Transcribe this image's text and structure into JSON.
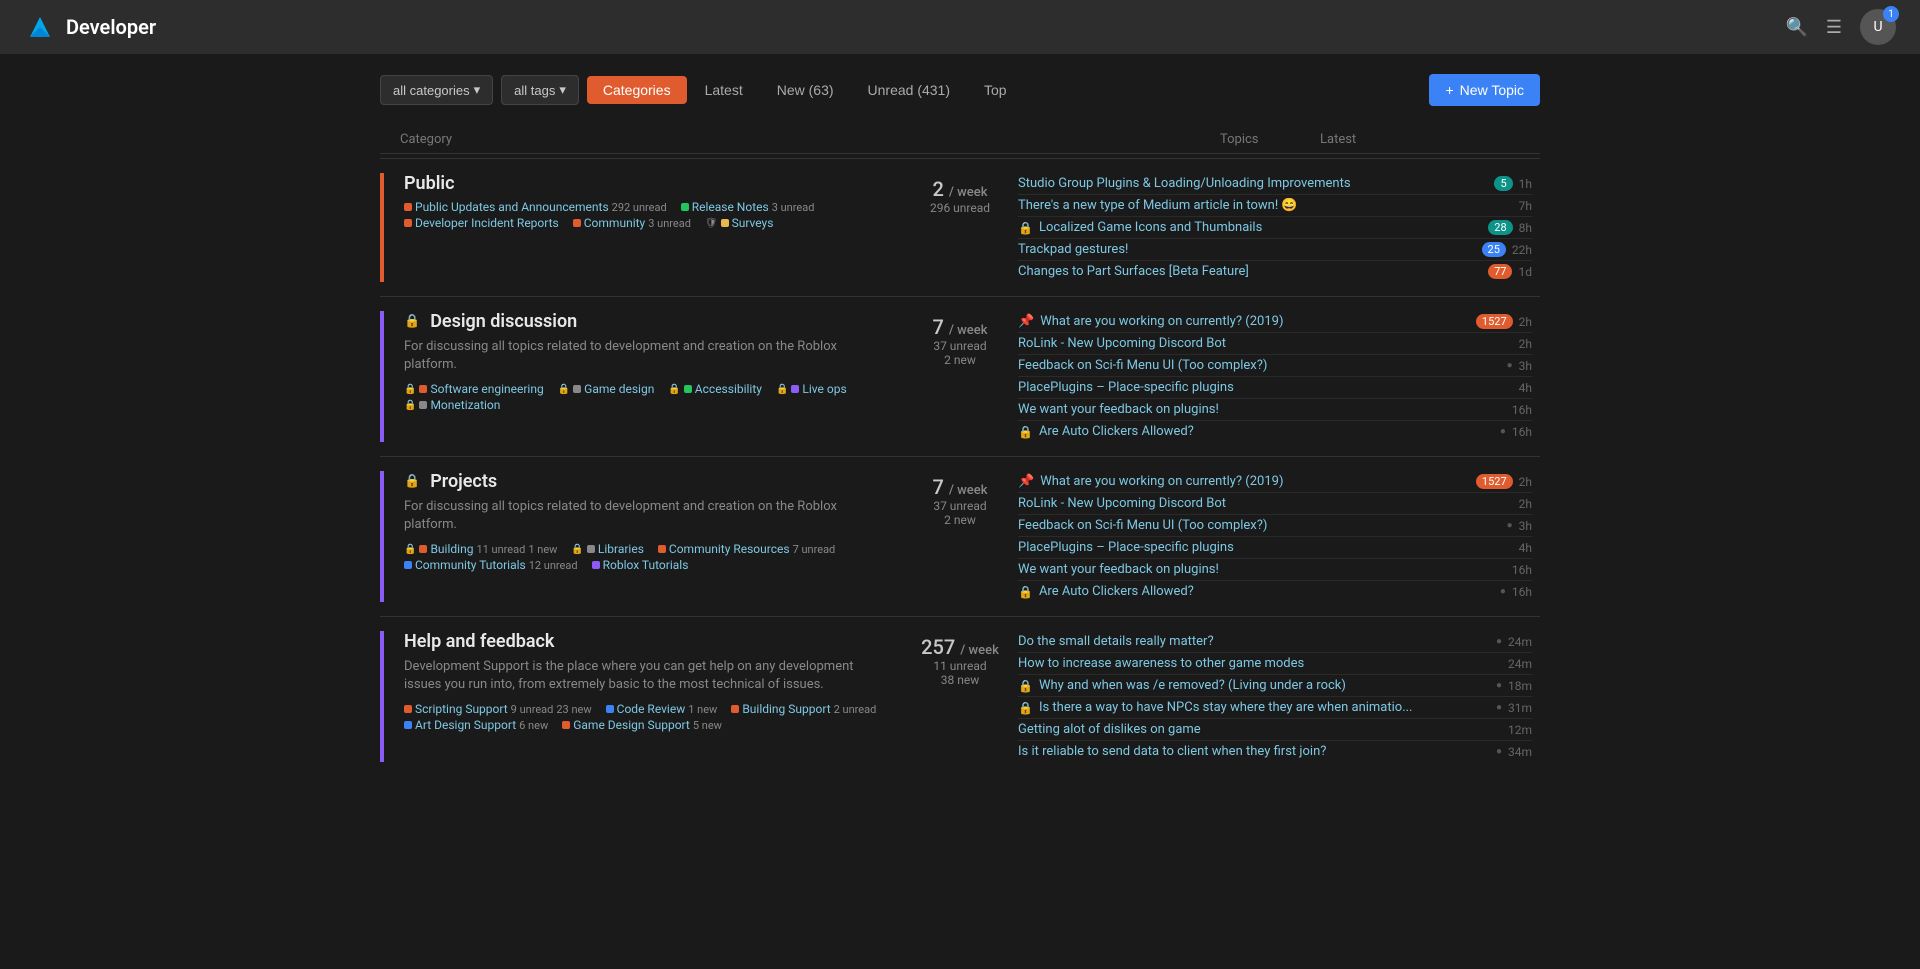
{
  "header": {
    "logo_text": "Developer",
    "search_icon": "🔍",
    "menu_icon": "☰",
    "avatar_badge": "1"
  },
  "topbar": {
    "filter_categories": "all categories",
    "filter_tags": "all tags",
    "tabs": [
      {
        "label": "Categories",
        "active": true
      },
      {
        "label": "Latest",
        "active": false
      },
      {
        "label": "New (63)",
        "active": false
      },
      {
        "label": "Unread (431)",
        "active": false
      },
      {
        "label": "Top",
        "active": false
      }
    ],
    "new_topic_label": "New Topic"
  },
  "table_header": {
    "col1": "Category",
    "col2": "Topics",
    "col3": "Latest"
  },
  "categories": [
    {
      "id": "public",
      "name": "Public",
      "lock": false,
      "color": "#e05c2e",
      "stats": {
        "num": "2",
        "per": "/ week",
        "unread": "296 unread"
      },
      "subcats": [
        {
          "name": "Public Updates and Announcements",
          "color": "#e05c2e",
          "unread": "292 unread"
        },
        {
          "name": "Release Notes",
          "color": "#22c55e",
          "unread": "3 unread"
        },
        {
          "name": "Developer Incident Reports",
          "color": "#e05c2e",
          "unread": ""
        },
        {
          "name": "Community",
          "color": "#e05c2e",
          "unread": "3 unread"
        },
        {
          "name": "Surveys",
          "color": "#e8b84b",
          "shield": true,
          "unread": ""
        }
      ],
      "topics": [
        {
          "title": "Studio Group Plugins & Loading/Unloading Improvements",
          "time": "1h",
          "badge": "5",
          "badge_color": "teal",
          "pinned": false,
          "lock": false
        },
        {
          "title": "There's a new type of Medium article in town! 😄",
          "time": "7h",
          "badge": "",
          "pinned": false,
          "lock": false
        },
        {
          "title": "Localized Game Icons and Thumbnails",
          "time": "8h",
          "badge": "28",
          "badge_color": "teal",
          "pinned": false,
          "lock": true
        },
        {
          "title": "Trackpad gestures!",
          "time": "22h",
          "badge": "25",
          "badge_color": "blue",
          "pinned": false,
          "lock": false
        },
        {
          "title": "Changes to Part Surfaces [Beta Feature]",
          "time": "1d",
          "badge": "77",
          "badge_color": "orange",
          "pinned": false,
          "lock": false
        }
      ]
    },
    {
      "id": "design",
      "name": "Design discussion",
      "lock": true,
      "color": "#8b5cf6",
      "desc": "For discussing all topics related to development and creation on the Roblox platform.",
      "stats": {
        "num": "7",
        "per": "/ week",
        "unread": "37 unread",
        "new": "2 new"
      },
      "subcats": [
        {
          "name": "Software engineering",
          "color": "#e05c2e",
          "lock": true,
          "unread": ""
        },
        {
          "name": "Game design",
          "color": "#888",
          "lock": true,
          "unread": ""
        },
        {
          "name": "Accessibility",
          "color": "#22c55e",
          "lock": true,
          "unread": ""
        },
        {
          "name": "Live ops",
          "color": "#8b5cf6",
          "lock": true,
          "unread": ""
        },
        {
          "name": "Monetization",
          "color": "#888",
          "lock": true,
          "unread": ""
        }
      ],
      "topics": [
        {
          "title": "What are you working on currently? (2019)",
          "time": "2h",
          "badge": "1527",
          "badge_color": "orange",
          "pinned": true,
          "lock": false
        },
        {
          "title": "RoLink - New Upcoming Discord Bot",
          "time": "2h",
          "badge": "",
          "pinned": false,
          "lock": false
        },
        {
          "title": "Feedback on Sci-fi Menu UI (Too complex?)",
          "time": "3h",
          "badge": "",
          "pinned": false,
          "lock": false,
          "dot": true
        },
        {
          "title": "PlacePlugins – Place-specific plugins",
          "time": "4h",
          "badge": "",
          "pinned": false,
          "lock": false
        },
        {
          "title": "We want your feedback on plugins!",
          "time": "16h",
          "badge": "",
          "pinned": false,
          "lock": false
        },
        {
          "title": "Are Auto Clickers Allowed?",
          "time": "16h",
          "badge": "",
          "pinned": false,
          "lock": true,
          "dot": true
        }
      ]
    },
    {
      "id": "projects",
      "name": "Projects",
      "lock": true,
      "color": "#8b5cf6",
      "desc": "For discussing all topics related to development and creation on the Roblox platform.",
      "stats": {
        "num": "7",
        "per": "/ week",
        "unread": "37 unread",
        "new": "2 new"
      },
      "subcats": [
        {
          "name": "Building",
          "color": "#e05c2e",
          "lock": true,
          "unread": "11 unread",
          "new": "1 new"
        },
        {
          "name": "Libraries",
          "color": "#888",
          "lock": true,
          "unread": ""
        },
        {
          "name": "Community Resources",
          "color": "#e05c2e",
          "unread": "7 unread"
        },
        {
          "name": "Community Tutorials",
          "color": "#3b82f6",
          "lock": false,
          "unread": "12 unread"
        },
        {
          "name": "Roblox Tutorials",
          "color": "#8b5cf6",
          "unread": ""
        }
      ],
      "topics": [
        {
          "title": "What are you working on currently? (2019)",
          "time": "2h",
          "badge": "1527",
          "badge_color": "orange",
          "pinned": true,
          "lock": false
        },
        {
          "title": "RoLink - New Upcoming Discord Bot",
          "time": "2h",
          "badge": "",
          "pinned": false,
          "lock": false
        },
        {
          "title": "Feedback on Sci-fi Menu UI (Too complex?)",
          "time": "3h",
          "badge": "",
          "pinned": false,
          "lock": false,
          "dot": true
        },
        {
          "title": "PlacePlugins – Place-specific plugins",
          "time": "4h",
          "badge": "",
          "pinned": false,
          "lock": false
        },
        {
          "title": "We want your feedback on plugins!",
          "time": "16h",
          "badge": "",
          "pinned": false,
          "lock": false
        },
        {
          "title": "Are Auto Clickers Allowed?",
          "time": "16h",
          "badge": "",
          "pinned": false,
          "lock": true,
          "dot": true
        }
      ]
    },
    {
      "id": "help",
      "name": "Help and feedback",
      "lock": false,
      "color": "#8b5cf6",
      "desc": "Development Support is the place where you can get help on any development issues you run into, from extremely basic to the most technical of issues.",
      "stats": {
        "num": "257",
        "per": "/ week",
        "unread": "11 unread",
        "new": "38 new"
      },
      "subcats": [
        {
          "name": "Scripting Support",
          "color": "#e05c2e",
          "unread": "9 unread",
          "new": "23 new"
        },
        {
          "name": "Code Review",
          "color": "#3b82f6",
          "unread": "",
          "new": "1 new"
        },
        {
          "name": "Building Support",
          "color": "#e05c2e",
          "unread": "2 unread",
          "new": ""
        },
        {
          "name": "Art Design Support",
          "color": "#3b82f6",
          "unread": "",
          "new": "6 new"
        },
        {
          "name": "Game Design Support",
          "color": "#e05c2e",
          "unread": "",
          "new": "5 new"
        }
      ],
      "topics": [
        {
          "title": "Do the small details really matter?",
          "time": "24m",
          "badge": "",
          "pinned": false,
          "lock": false,
          "dot": true
        },
        {
          "title": "How to increase awareness to other game modes",
          "time": "24m",
          "badge": "",
          "pinned": false,
          "lock": false
        },
        {
          "title": "Why and when was /e removed? (Living under a rock)",
          "time": "18m",
          "badge": "",
          "pinned": false,
          "lock": true,
          "dot": true
        },
        {
          "title": "Is there a way to have NPCs stay where they are when animatio...",
          "time": "31m",
          "badge": "",
          "pinned": false,
          "lock": true,
          "dot": true
        },
        {
          "title": "Getting alot of dislikes on game",
          "time": "12m",
          "badge": "",
          "pinned": false,
          "lock": false
        },
        {
          "title": "Is it reliable to send data to client when they first join?",
          "time": "34m",
          "badge": "",
          "pinned": false,
          "lock": false,
          "dot": true
        }
      ]
    }
  ]
}
